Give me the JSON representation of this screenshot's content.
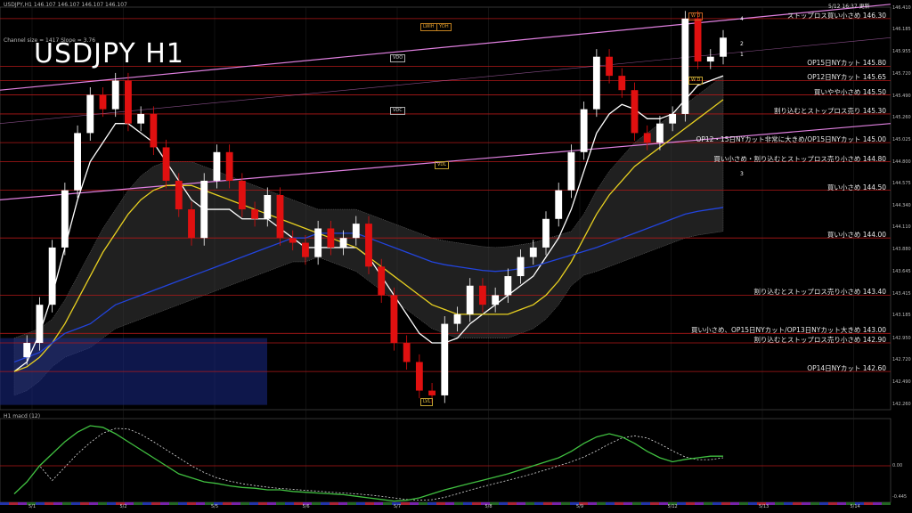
{
  "header": {
    "symbol_line": "USDJPY,H1  146.107 146.107 146.107 146.107",
    "channel_info": "Channel size = 1417 Slope = 3.76",
    "title": "USDJPY  H1",
    "updated": "5/12 16:37 更新",
    "macd_label": "H1  macd (12)"
  },
  "levels": [
    {
      "price": 146.3,
      "label": "ストップロス買い小さめ 146.30"
    },
    {
      "price": 145.8,
      "label": "OP15日NYカット 145.80"
    },
    {
      "price": 145.65,
      "label": "OP12日NYカット 145.65"
    },
    {
      "price": 145.5,
      "label": "買いやや小さめ 145.50"
    },
    {
      "price": 145.3,
      "label": "割り込むとストップロス売り 145.30"
    },
    {
      "price": 145.0,
      "label": "OP12・15日NYカット非常に大きめ/OP15日NYカット 145.00"
    },
    {
      "price": 144.8,
      "label": "買い小さめ・割り込むとストップロス売り小さめ 144.80"
    },
    {
      "price": 144.5,
      "label": "買い小さめ 144.50"
    },
    {
      "price": 144.0,
      "label": "買い小さめ 144.00"
    },
    {
      "price": 143.4,
      "label": "割り込むとストップロス売り小さめ 143.40"
    },
    {
      "price": 143.0,
      "label": "買い小さめ、OP15日NYカット/OP13日NYカット大きめ 143.00"
    },
    {
      "price": 142.9,
      "label": "割り込むとストップロス売り小さめ 142.90"
    },
    {
      "price": 142.6,
      "label": "OP14日NYカット 142.60"
    }
  ],
  "markers": {
    "vdo": "VDO",
    "vdc": "VDC",
    "vdl": "VDL",
    "lvl": "LVL",
    "lwh": "LWIH",
    "ydh": "YDH",
    "wd_top": "W D",
    "wd_low": "W D",
    "n1": "1",
    "n2": "2",
    "n3": "3",
    "n4": "4"
  },
  "chart_data": {
    "type": "line",
    "title": "USDJPY  H1",
    "ylim": [
      142.2,
      146.42
    ],
    "y_ticks": [
      "146.410",
      "146.185",
      "145.955",
      "145.720",
      "145.490",
      "145.260",
      "145.025",
      "144.800",
      "144.575",
      "144.340",
      "144.110",
      "143.880",
      "143.645",
      "143.415",
      "143.185",
      "142.950",
      "142.720",
      "142.490",
      "142.260"
    ],
    "x_ticks": [
      "5/1",
      "5/2",
      "5/5",
      "5/6",
      "5/7",
      "5/8",
      "5/9",
      "5/12",
      "5/13",
      "5/14"
    ],
    "macd_ticks": [
      "0.00",
      "-0.445"
    ],
    "series": [
      {
        "name": "close",
        "values": [
          142.75,
          142.9,
          143.3,
          143.9,
          144.5,
          145.1,
          145.5,
          145.35,
          145.65,
          145.2,
          145.3,
          144.95,
          144.6,
          144.3,
          144.0,
          144.6,
          144.9,
          144.6,
          144.3,
          144.2,
          144.45,
          144.0,
          143.95,
          143.8,
          144.1,
          143.9,
          144.0,
          144.15,
          143.7,
          143.4,
          142.9,
          142.7,
          142.4,
          142.35,
          143.1,
          143.2,
          143.5,
          143.3,
          143.4,
          143.6,
          143.8,
          143.9,
          144.2,
          144.5,
          144.9,
          145.35,
          145.9,
          145.7,
          145.55,
          145.1,
          145.0,
          145.2,
          145.3,
          146.3,
          145.85,
          145.9,
          146.1
        ]
      },
      {
        "name": "ma_fast",
        "values": [
          142.6,
          142.7,
          143.0,
          143.4,
          143.9,
          144.4,
          144.8,
          145.0,
          145.2,
          145.2,
          145.1,
          145.0,
          144.8,
          144.6,
          144.4,
          144.3,
          144.3,
          144.3,
          144.2,
          144.2,
          144.2,
          144.1,
          144.0,
          143.9,
          143.9,
          143.9,
          143.9,
          143.9,
          143.8,
          143.6,
          143.4,
          143.2,
          143.0,
          142.9,
          142.9,
          142.95,
          143.1,
          143.2,
          143.3,
          143.4,
          143.5,
          143.6,
          143.8,
          144.0,
          144.3,
          144.7,
          145.1,
          145.3,
          145.4,
          145.35,
          145.25,
          145.25,
          145.3,
          145.45,
          145.6,
          145.65,
          145.7
        ]
      },
      {
        "name": "ma_slow",
        "values": [
          142.6,
          142.65,
          142.75,
          142.9,
          143.1,
          143.35,
          143.6,
          143.85,
          144.05,
          144.25,
          144.4,
          144.5,
          144.55,
          144.55,
          144.55,
          144.5,
          144.45,
          144.4,
          144.35,
          144.3,
          144.25,
          144.2,
          144.15,
          144.1,
          144.05,
          144.0,
          143.95,
          143.9,
          143.8,
          143.7,
          143.6,
          143.5,
          143.4,
          143.3,
          143.25,
          143.2,
          143.2,
          143.2,
          143.2,
          143.2,
          143.25,
          143.3,
          143.4,
          143.55,
          143.75,
          144.0,
          144.25,
          144.45,
          144.6,
          144.75,
          144.85,
          144.95,
          145.05,
          145.15,
          145.25,
          145.35,
          145.45
        ]
      },
      {
        "name": "ma_long",
        "values": [
          142.7,
          142.75,
          142.8,
          142.9,
          143.0,
          143.05,
          143.1,
          143.2,
          143.3,
          143.35,
          143.4,
          143.45,
          143.5,
          143.55,
          143.6,
          143.65,
          143.7,
          143.75,
          143.8,
          143.85,
          143.9,
          143.95,
          144.0,
          144.0,
          144.05,
          144.05,
          144.05,
          144.05,
          144.0,
          143.95,
          143.9,
          143.85,
          143.8,
          143.75,
          143.72,
          143.7,
          143.68,
          143.66,
          143.65,
          143.66,
          143.68,
          143.7,
          143.74,
          143.78,
          143.82,
          143.86,
          143.9,
          143.95,
          144.0,
          144.05,
          144.1,
          144.15,
          144.2,
          144.25,
          144.28,
          144.3,
          144.32
        ]
      }
    ],
    "macd": [
      -0.35,
      -0.2,
      0.0,
      0.15,
      0.3,
      0.42,
      0.5,
      0.48,
      0.4,
      0.3,
      0.2,
      0.1,
      0.0,
      -0.1,
      -0.15,
      -0.2,
      -0.22,
      -0.25,
      -0.27,
      -0.28,
      -0.3,
      -0.3,
      -0.32,
      -0.33,
      -0.34,
      -0.35,
      -0.36,
      -0.38,
      -0.4,
      -0.42,
      -0.44,
      -0.43,
      -0.4,
      -0.35,
      -0.3,
      -0.26,
      -0.22,
      -0.18,
      -0.14,
      -0.1,
      -0.05,
      0.0,
      0.05,
      0.1,
      0.18,
      0.28,
      0.36,
      0.4,
      0.36,
      0.28,
      0.18,
      0.1,
      0.05,
      0.08,
      0.1,
      0.12,
      0.12
    ]
  }
}
